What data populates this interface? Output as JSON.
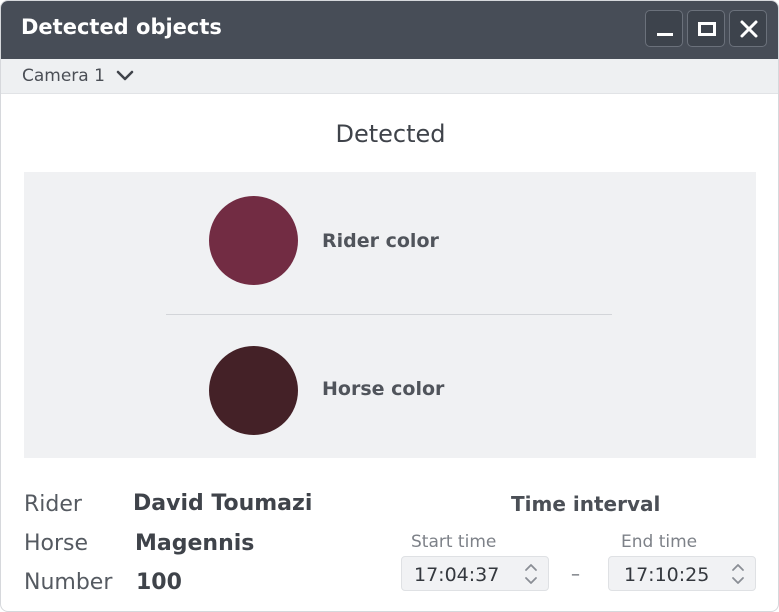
{
  "window": {
    "title": "Detected objects",
    "controls": [
      "minimize-icon",
      "maximize-icon",
      "close-icon"
    ]
  },
  "camera": {
    "selected": "Camera 1"
  },
  "detected": {
    "heading": "Detected",
    "rider": {
      "label": "Rider color",
      "color": "#722c43"
    },
    "horse": {
      "label": "Horse color",
      "color": "#442127"
    }
  },
  "info": {
    "rider": {
      "key": "Rider",
      "value": "David Toumazi"
    },
    "horse": {
      "key": "Horse",
      "value": "Magennis"
    },
    "number": {
      "key": "Number",
      "value": "100"
    }
  },
  "time_interval": {
    "heading": "Time interval",
    "start": {
      "caption": "Start time",
      "value": "17:04:37"
    },
    "separator": "–",
    "end": {
      "caption": "End time",
      "value": "17:10:25"
    }
  }
}
